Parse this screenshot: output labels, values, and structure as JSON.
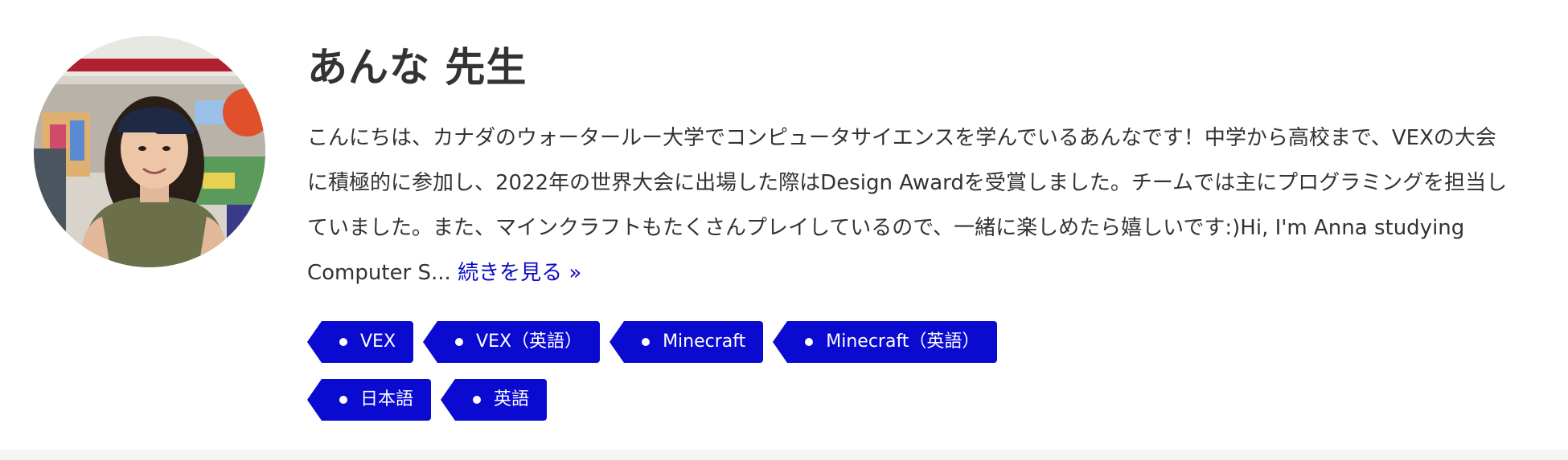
{
  "teacher": {
    "name": "あんな 先生",
    "avatar_alt": "teacher photo",
    "bio_text": "こんにちは、カナダのウォータールー大学でコンピュータサイエンスを学んでいるあんなです！中学から高校まで、VEXの大会に積極的に参加し、2022年の世界大会に出場した際はDesign Awardを受賞しました。チームでは主にプログラミングを担当していました。また、マインクラフトもたくさんプレイしているので、一緒に楽しめたら嬉しいです:)Hi, I'm Anna studying Computer S...",
    "read_more_label": "続きを見る »"
  },
  "tags": {
    "row1": [
      "VEX",
      "VEX（英語）",
      "Minecraft",
      "Minecraft（英語）"
    ],
    "row2": [
      "日本語",
      "英語"
    ]
  },
  "colors": {
    "tag_background": "#0a0ad0",
    "link": "#0a0ac8",
    "text": "#333333"
  },
  "icons": {
    "tag_marker": "dot-icon"
  }
}
